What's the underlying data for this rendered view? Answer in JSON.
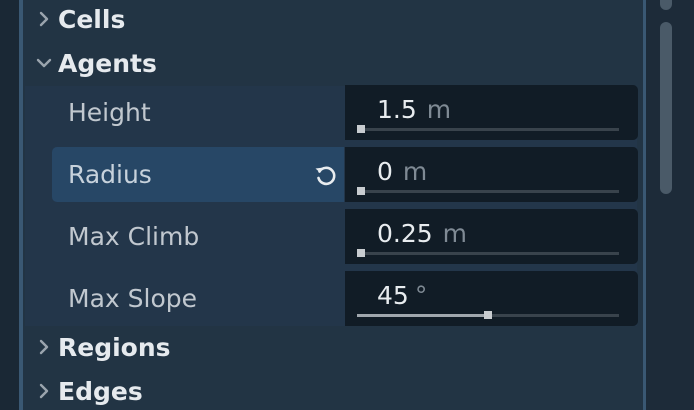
{
  "sections": {
    "cells": "Cells",
    "agents": "Agents",
    "regions": "Regions",
    "edges": "Edges"
  },
  "agents": {
    "rows": [
      {
        "label": "Height",
        "value": "1.5",
        "unit": "m",
        "slider_fraction": 0.0
      },
      {
        "label": "Radius",
        "value": "0",
        "unit": "m",
        "slider_fraction": 0.0,
        "highlighted": true,
        "reset_icon": "reset-icon"
      },
      {
        "label": "Max Climb",
        "value": "0.25",
        "unit": "m",
        "slider_fraction": 0.0
      },
      {
        "label": "Max Slope",
        "value": "45",
        "unit": "°",
        "slider_fraction": 0.5
      }
    ]
  },
  "colors": {
    "panel_bg": "#223444",
    "highlight": "#274766",
    "value_bg": "#111c26",
    "accent_line": "#3a5873"
  },
  "icons": {
    "collapsed": "chevron-right-icon",
    "expanded": "chevron-down-icon",
    "reset": "reset-icon"
  }
}
